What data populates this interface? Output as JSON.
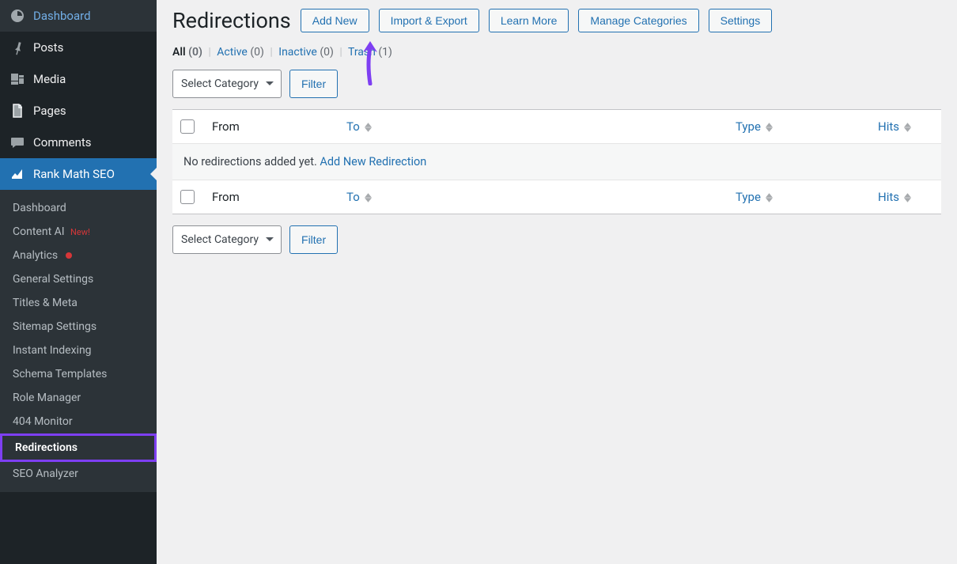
{
  "sidebar": {
    "main_items": [
      {
        "label": "Dashboard",
        "icon": "dashboard"
      },
      {
        "label": "Posts",
        "icon": "pin"
      },
      {
        "label": "Media",
        "icon": "media"
      },
      {
        "label": "Pages",
        "icon": "page"
      },
      {
        "label": "Comments",
        "icon": "comment"
      },
      {
        "label": "Rank Math SEO",
        "icon": "chart",
        "active": true
      }
    ],
    "sub_items": [
      {
        "label": "Dashboard"
      },
      {
        "label": "Content AI",
        "new": true
      },
      {
        "label": "Analytics",
        "dot": true
      },
      {
        "label": "General Settings"
      },
      {
        "label": "Titles & Meta"
      },
      {
        "label": "Sitemap Settings"
      },
      {
        "label": "Instant Indexing"
      },
      {
        "label": "Schema Templates"
      },
      {
        "label": "Role Manager"
      },
      {
        "label": "404 Monitor"
      },
      {
        "label": "Redirections",
        "highlighted": true
      },
      {
        "label": "SEO Analyzer"
      }
    ],
    "new_badge": "New!"
  },
  "header": {
    "title": "Redirections",
    "buttons": [
      "Add New",
      "Import & Export",
      "Learn More",
      "Manage Categories",
      "Settings"
    ]
  },
  "status": {
    "all_label": "All",
    "all_count": "(0)",
    "active_label": "Active",
    "active_count": "(0)",
    "inactive_label": "Inactive",
    "inactive_count": "(0)",
    "trash_label": "Trash",
    "trash_count": "(1)"
  },
  "filter": {
    "select_label": "Select Category",
    "filter_label": "Filter"
  },
  "table": {
    "col_from": "From",
    "col_to": "To",
    "col_type": "Type",
    "col_hits": "Hits",
    "empty_text": "No redirections added yet. ",
    "empty_link": "Add New Redirection"
  }
}
